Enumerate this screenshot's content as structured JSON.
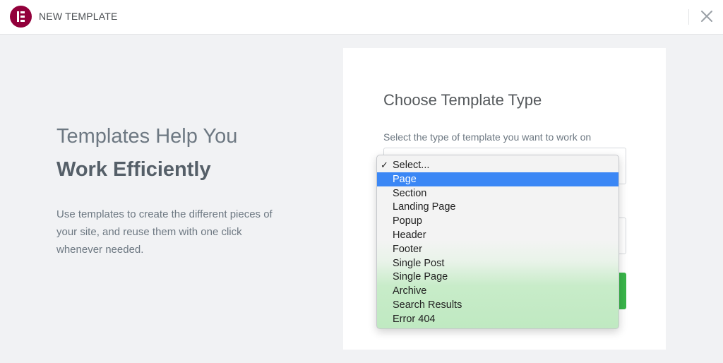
{
  "header": {
    "title": "NEW TEMPLATE",
    "logo_icon": "elementor-logo-icon",
    "close_icon": "close-icon",
    "brand_color": "#92003b"
  },
  "intro": {
    "heading_line1": "Templates Help You",
    "heading_line2": "Work Efficiently",
    "body": "Use templates to create the different pieces of your site, and reuse them with one click whenever needed."
  },
  "form": {
    "title": "Choose Template Type",
    "type_label": "Select the type of template you want to work on",
    "submit_color": "#39b54a"
  },
  "dropdown": {
    "checked_option": "Select...",
    "highlighted_option": "Page",
    "highlight_color": "#3b87f5",
    "options": [
      "Select...",
      "Page",
      "Section",
      "Landing Page",
      "Popup",
      "Header",
      "Footer",
      "Single Post",
      "Single Page",
      "Archive",
      "Search Results",
      "Error 404"
    ]
  }
}
